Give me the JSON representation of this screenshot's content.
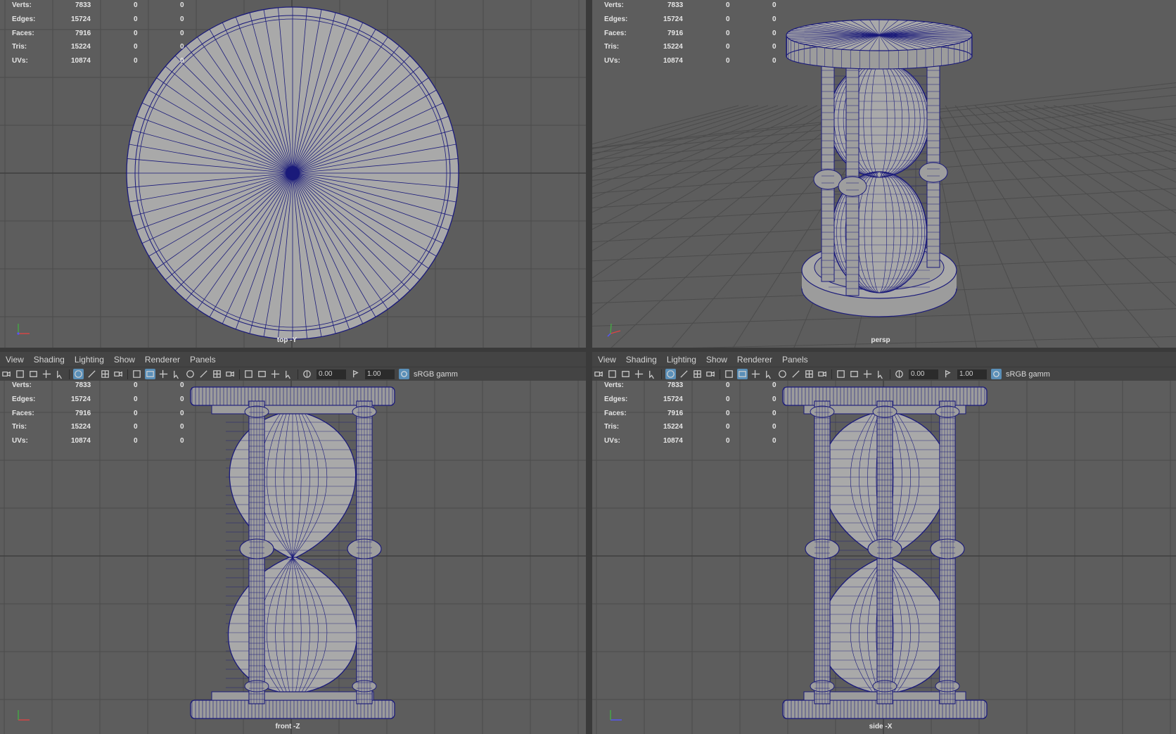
{
  "stats": {
    "rows": [
      {
        "label": "Verts:",
        "values": [
          "7833",
          "0",
          "0"
        ]
      },
      {
        "label": "Edges:",
        "values": [
          "15724",
          "0",
          "0"
        ]
      },
      {
        "label": "Faces:",
        "values": [
          "7916",
          "0",
          "0"
        ]
      },
      {
        "label": "Tris:",
        "values": [
          "15224",
          "0",
          "0"
        ]
      },
      {
        "label": "UVs:",
        "values": [
          "10874",
          "0",
          "0"
        ]
      }
    ]
  },
  "viewports": {
    "top": {
      "camera": "top -Y"
    },
    "persp": {
      "camera": "persp"
    },
    "front": {
      "camera": "front -Z"
    },
    "side": {
      "camera": "side -X"
    }
  },
  "panel_menu": [
    "View",
    "Shading",
    "Lighting",
    "Show",
    "Renderer",
    "Panels"
  ],
  "toolbar": {
    "exposure": "0.00",
    "gamma": "1.00",
    "color_space": "sRGB gamm"
  },
  "colors": {
    "viewport_bg": "#5d5d5d",
    "grid": "#4c4c4c",
    "wireframe": "#1a1a7a",
    "shaded": "#a9a9a9",
    "panel_bg": "#444444"
  }
}
